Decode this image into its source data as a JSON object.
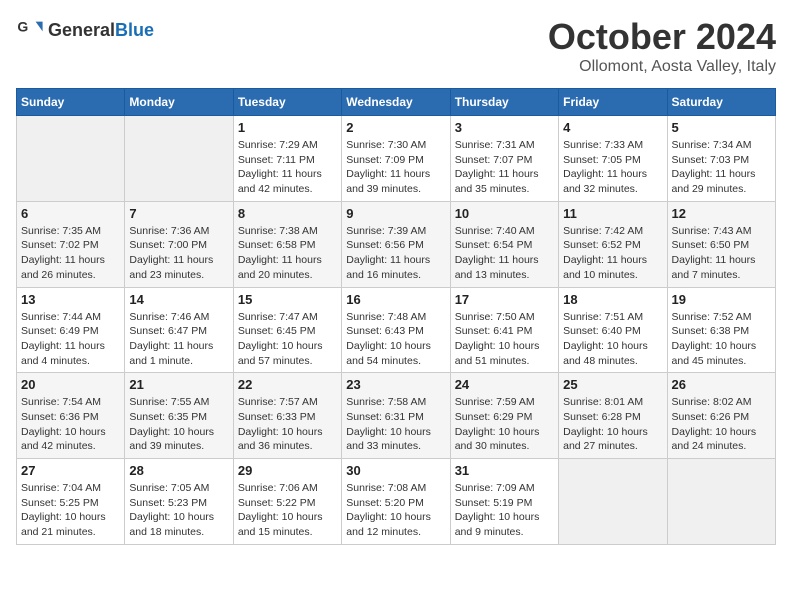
{
  "header": {
    "logo_general": "General",
    "logo_blue": "Blue",
    "month": "October 2024",
    "location": "Ollomont, Aosta Valley, Italy"
  },
  "weekdays": [
    "Sunday",
    "Monday",
    "Tuesday",
    "Wednesday",
    "Thursday",
    "Friday",
    "Saturday"
  ],
  "weeks": [
    [
      {
        "day": "",
        "sunrise": "",
        "sunset": "",
        "daylight": ""
      },
      {
        "day": "",
        "sunrise": "",
        "sunset": "",
        "daylight": ""
      },
      {
        "day": "1",
        "sunrise": "Sunrise: 7:29 AM",
        "sunset": "Sunset: 7:11 PM",
        "daylight": "Daylight: 11 hours and 42 minutes."
      },
      {
        "day": "2",
        "sunrise": "Sunrise: 7:30 AM",
        "sunset": "Sunset: 7:09 PM",
        "daylight": "Daylight: 11 hours and 39 minutes."
      },
      {
        "day": "3",
        "sunrise": "Sunrise: 7:31 AM",
        "sunset": "Sunset: 7:07 PM",
        "daylight": "Daylight: 11 hours and 35 minutes."
      },
      {
        "day": "4",
        "sunrise": "Sunrise: 7:33 AM",
        "sunset": "Sunset: 7:05 PM",
        "daylight": "Daylight: 11 hours and 32 minutes."
      },
      {
        "day": "5",
        "sunrise": "Sunrise: 7:34 AM",
        "sunset": "Sunset: 7:03 PM",
        "daylight": "Daylight: 11 hours and 29 minutes."
      }
    ],
    [
      {
        "day": "6",
        "sunrise": "Sunrise: 7:35 AM",
        "sunset": "Sunset: 7:02 PM",
        "daylight": "Daylight: 11 hours and 26 minutes."
      },
      {
        "day": "7",
        "sunrise": "Sunrise: 7:36 AM",
        "sunset": "Sunset: 7:00 PM",
        "daylight": "Daylight: 11 hours and 23 minutes."
      },
      {
        "day": "8",
        "sunrise": "Sunrise: 7:38 AM",
        "sunset": "Sunset: 6:58 PM",
        "daylight": "Daylight: 11 hours and 20 minutes."
      },
      {
        "day": "9",
        "sunrise": "Sunrise: 7:39 AM",
        "sunset": "Sunset: 6:56 PM",
        "daylight": "Daylight: 11 hours and 16 minutes."
      },
      {
        "day": "10",
        "sunrise": "Sunrise: 7:40 AM",
        "sunset": "Sunset: 6:54 PM",
        "daylight": "Daylight: 11 hours and 13 minutes."
      },
      {
        "day": "11",
        "sunrise": "Sunrise: 7:42 AM",
        "sunset": "Sunset: 6:52 PM",
        "daylight": "Daylight: 11 hours and 10 minutes."
      },
      {
        "day": "12",
        "sunrise": "Sunrise: 7:43 AM",
        "sunset": "Sunset: 6:50 PM",
        "daylight": "Daylight: 11 hours and 7 minutes."
      }
    ],
    [
      {
        "day": "13",
        "sunrise": "Sunrise: 7:44 AM",
        "sunset": "Sunset: 6:49 PM",
        "daylight": "Daylight: 11 hours and 4 minutes."
      },
      {
        "day": "14",
        "sunrise": "Sunrise: 7:46 AM",
        "sunset": "Sunset: 6:47 PM",
        "daylight": "Daylight: 11 hours and 1 minute."
      },
      {
        "day": "15",
        "sunrise": "Sunrise: 7:47 AM",
        "sunset": "Sunset: 6:45 PM",
        "daylight": "Daylight: 10 hours and 57 minutes."
      },
      {
        "day": "16",
        "sunrise": "Sunrise: 7:48 AM",
        "sunset": "Sunset: 6:43 PM",
        "daylight": "Daylight: 10 hours and 54 minutes."
      },
      {
        "day": "17",
        "sunrise": "Sunrise: 7:50 AM",
        "sunset": "Sunset: 6:41 PM",
        "daylight": "Daylight: 10 hours and 51 minutes."
      },
      {
        "day": "18",
        "sunrise": "Sunrise: 7:51 AM",
        "sunset": "Sunset: 6:40 PM",
        "daylight": "Daylight: 10 hours and 48 minutes."
      },
      {
        "day": "19",
        "sunrise": "Sunrise: 7:52 AM",
        "sunset": "Sunset: 6:38 PM",
        "daylight": "Daylight: 10 hours and 45 minutes."
      }
    ],
    [
      {
        "day": "20",
        "sunrise": "Sunrise: 7:54 AM",
        "sunset": "Sunset: 6:36 PM",
        "daylight": "Daylight: 10 hours and 42 minutes."
      },
      {
        "day": "21",
        "sunrise": "Sunrise: 7:55 AM",
        "sunset": "Sunset: 6:35 PM",
        "daylight": "Daylight: 10 hours and 39 minutes."
      },
      {
        "day": "22",
        "sunrise": "Sunrise: 7:57 AM",
        "sunset": "Sunset: 6:33 PM",
        "daylight": "Daylight: 10 hours and 36 minutes."
      },
      {
        "day": "23",
        "sunrise": "Sunrise: 7:58 AM",
        "sunset": "Sunset: 6:31 PM",
        "daylight": "Daylight: 10 hours and 33 minutes."
      },
      {
        "day": "24",
        "sunrise": "Sunrise: 7:59 AM",
        "sunset": "Sunset: 6:29 PM",
        "daylight": "Daylight: 10 hours and 30 minutes."
      },
      {
        "day": "25",
        "sunrise": "Sunrise: 8:01 AM",
        "sunset": "Sunset: 6:28 PM",
        "daylight": "Daylight: 10 hours and 27 minutes."
      },
      {
        "day": "26",
        "sunrise": "Sunrise: 8:02 AM",
        "sunset": "Sunset: 6:26 PM",
        "daylight": "Daylight: 10 hours and 24 minutes."
      }
    ],
    [
      {
        "day": "27",
        "sunrise": "Sunrise: 7:04 AM",
        "sunset": "Sunset: 5:25 PM",
        "daylight": "Daylight: 10 hours and 21 minutes."
      },
      {
        "day": "28",
        "sunrise": "Sunrise: 7:05 AM",
        "sunset": "Sunset: 5:23 PM",
        "daylight": "Daylight: 10 hours and 18 minutes."
      },
      {
        "day": "29",
        "sunrise": "Sunrise: 7:06 AM",
        "sunset": "Sunset: 5:22 PM",
        "daylight": "Daylight: 10 hours and 15 minutes."
      },
      {
        "day": "30",
        "sunrise": "Sunrise: 7:08 AM",
        "sunset": "Sunset: 5:20 PM",
        "daylight": "Daylight: 10 hours and 12 minutes."
      },
      {
        "day": "31",
        "sunrise": "Sunrise: 7:09 AM",
        "sunset": "Sunset: 5:19 PM",
        "daylight": "Daylight: 10 hours and 9 minutes."
      },
      {
        "day": "",
        "sunrise": "",
        "sunset": "",
        "daylight": ""
      },
      {
        "day": "",
        "sunrise": "",
        "sunset": "",
        "daylight": ""
      }
    ]
  ]
}
